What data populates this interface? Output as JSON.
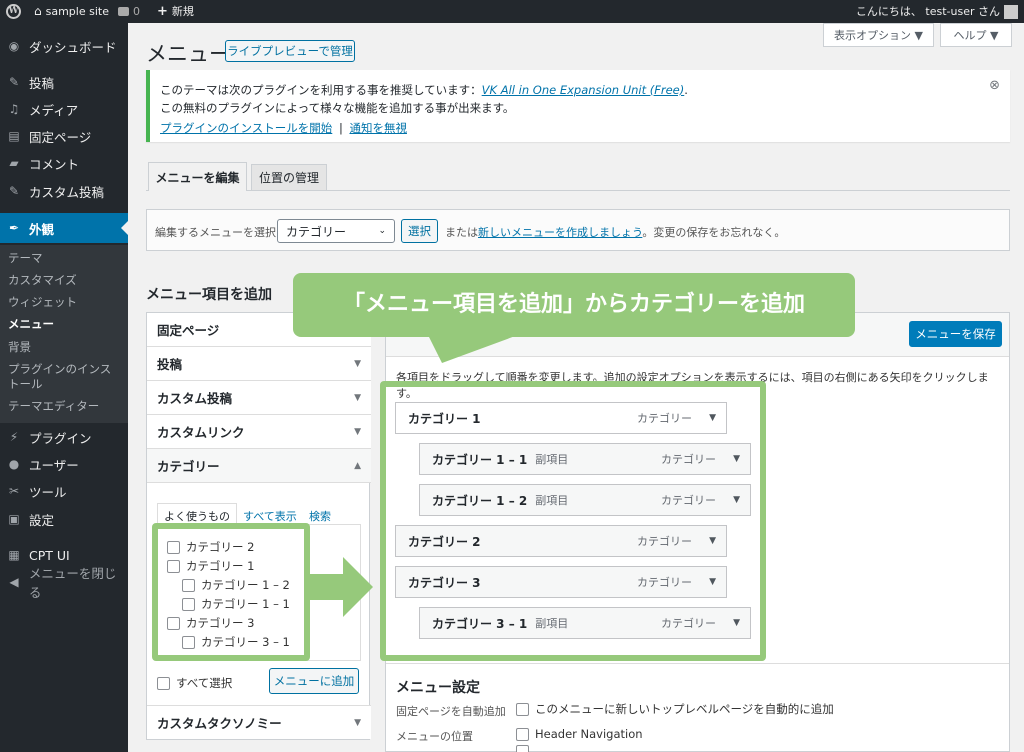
{
  "adminbar": {
    "site_name": "sample site",
    "comments_count": "0",
    "new_label": "新規",
    "greeting": "こんにちは、 test-user さん"
  },
  "sidebar": {
    "items": [
      {
        "label": "ダッシュボード",
        "icon": "dashboard-icon"
      },
      {
        "label": "投稿",
        "icon": "pin-icon"
      },
      {
        "label": "メディア",
        "icon": "media-icon"
      },
      {
        "label": "固定ページ",
        "icon": "page-icon"
      },
      {
        "label": "コメント",
        "icon": "comment-icon"
      },
      {
        "label": "カスタム投稿",
        "icon": "pin-icon"
      },
      {
        "label": "外観",
        "icon": "appearance-icon"
      },
      {
        "label": "プラグイン",
        "icon": "plugin-icon"
      },
      {
        "label": "ユーザー",
        "icon": "user-icon"
      },
      {
        "label": "ツール",
        "icon": "wrench-icon"
      },
      {
        "label": "設定",
        "icon": "settings-icon"
      },
      {
        "label": "CPT UI",
        "icon": "grid-icon"
      },
      {
        "label": "メニューを閉じる",
        "icon": "collapse-icon"
      }
    ],
    "submenu": [
      "テーマ",
      "カスタマイズ",
      "ウィジェット",
      "メニュー",
      "背景",
      "プラグインのインストール",
      "テーマエディター"
    ]
  },
  "header": {
    "title": "メニュー",
    "live_preview": "ライブプレビューで管理",
    "screen_options": "表示オプション ▼",
    "help": "ヘルプ ▼"
  },
  "notice": {
    "line1_prefix": "このテーマは次のプラグインを利用する事を推奨しています：",
    "line1_link": "VK All in One Expansion Unit (Free)",
    "line1_suffix": ".",
    "line2": "この無料のプラグインによって様々な機能を追加する事が出来ます。",
    "begin_install": "プラグインのインストールを開始",
    "separator": "|",
    "dismiss": "通知を無視",
    "close_symbol": "⊗"
  },
  "tabs": [
    "メニューを編集",
    "位置の管理"
  ],
  "select_bar": {
    "label": "編集するメニューを選択:",
    "selected": "カテゴリー",
    "select_btn": "選択",
    "or_text": "または",
    "create_link": "新しいメニューを作成しましょう",
    "suffix": "。変更の保存をお忘れなく。"
  },
  "add_items": {
    "heading": "メニュー項目を追加",
    "sections": [
      "固定ページ",
      "投稿",
      "カスタム投稿",
      "カスタムリンク",
      "カテゴリー"
    ],
    "taxonomy": "カスタムタクソノミー",
    "cat_tabs": [
      "よく使うもの",
      "すべて表示",
      "検索"
    ],
    "checkboxes": [
      "カテゴリー 2",
      "カテゴリー 1",
      "カテゴリー 1 – 2",
      "カテゴリー 1 – 1",
      "カテゴリー 3",
      "カテゴリー 3 – 1"
    ],
    "select_all": "すべて選択",
    "add_btn": "メニューに追加"
  },
  "callout": "「メニュー項目を追加」からカテゴリーを追加",
  "structure": {
    "save_btn": "メニューを保存",
    "instructions": "各項目をドラッグして順番を変更します。追加の設定オプションを表示するには、項目の右側にある矢印をクリックします。",
    "items": [
      {
        "title": "カテゴリー 1",
        "sub": "",
        "type": "カテゴリー"
      },
      {
        "title": "カテゴリー 1 – 1",
        "sub": "副項目",
        "type": "カテゴリー"
      },
      {
        "title": "カテゴリー 1 – 2",
        "sub": "副項目",
        "type": "カテゴリー"
      },
      {
        "title": "カテゴリー 2",
        "sub": "",
        "type": "カテゴリー"
      },
      {
        "title": "カテゴリー 3",
        "sub": "",
        "type": "カテゴリー"
      },
      {
        "title": "カテゴリー 3 – 1",
        "sub": "副項目",
        "type": "カテゴリー"
      }
    ]
  },
  "settings": {
    "heading": "メニュー設定",
    "auto_add_label": "固定ページを自動追加",
    "auto_add_text": "このメニューに新しいトップレベルページを自動的に追加",
    "location_label": "メニューの位置",
    "location_1": "Header Navigation"
  },
  "colors": {
    "accent": "#0073aa",
    "highlight": "#96c97b",
    "sidebar": "#23282d"
  }
}
